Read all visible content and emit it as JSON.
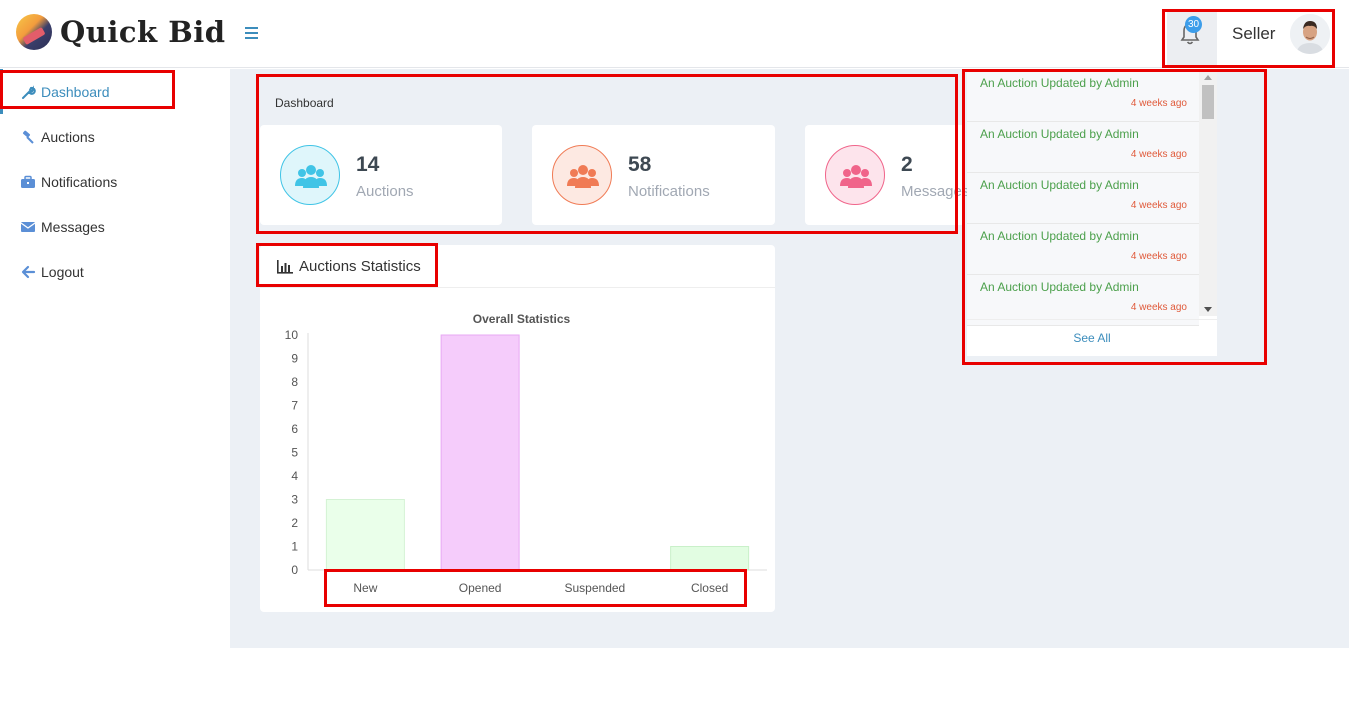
{
  "app": {
    "brand": "Quick Bid"
  },
  "header": {
    "notification_count": "30",
    "user_role": "Seller"
  },
  "sidebar": {
    "items": [
      {
        "label": "Dashboard",
        "icon": "wrench-icon",
        "active": true
      },
      {
        "label": "Auctions",
        "icon": "gavel-icon"
      },
      {
        "label": "Notifications",
        "icon": "briefcase-icon"
      },
      {
        "label": "Messages",
        "icon": "envelope-icon"
      },
      {
        "label": "Logout",
        "icon": "arrow-left-icon"
      }
    ]
  },
  "main": {
    "breadcrumb": "Dashboard",
    "cards": [
      {
        "value": "14",
        "label": "Auctions",
        "color": "#40c4e6",
        "bg": "#dff6fb"
      },
      {
        "value": "58",
        "label": "Notifications",
        "color": "#f07b55",
        "bg": "#fde9e2"
      },
      {
        "value": "2",
        "label": "Messages",
        "color": "#f0648a",
        "bg": "#fde4ec"
      }
    ],
    "stats_title": "Auctions Statistics"
  },
  "chart_data": {
    "type": "bar",
    "title": "Overall Statistics",
    "categories": [
      "New",
      "Opened",
      "Suspended",
      "Closed"
    ],
    "values": [
      3,
      10,
      0,
      1
    ],
    "colors": [
      "#eaffea",
      "#f5ccfb",
      "#eaffea",
      "#e2fde2"
    ],
    "border_colors": [
      "#d4f2d4",
      "#e7a9f3",
      "#d4f2d4",
      "#c9f0c9"
    ],
    "ylim": [
      0,
      10
    ],
    "yticks": [
      0,
      1,
      2,
      3,
      4,
      5,
      6,
      7,
      8,
      9,
      10
    ]
  },
  "notifications": {
    "items": [
      {
        "text": "An Auction Updated by Admin",
        "time": "4 weeks ago"
      },
      {
        "text": "An Auction Updated by Admin",
        "time": "4 weeks ago"
      },
      {
        "text": "An Auction Updated by Admin",
        "time": "4 weeks ago"
      },
      {
        "text": "An Auction Updated by Admin",
        "time": "4 weeks ago"
      },
      {
        "text": "An Auction Updated by Admin",
        "time": "4 weeks ago"
      }
    ],
    "see_all": "See All"
  }
}
